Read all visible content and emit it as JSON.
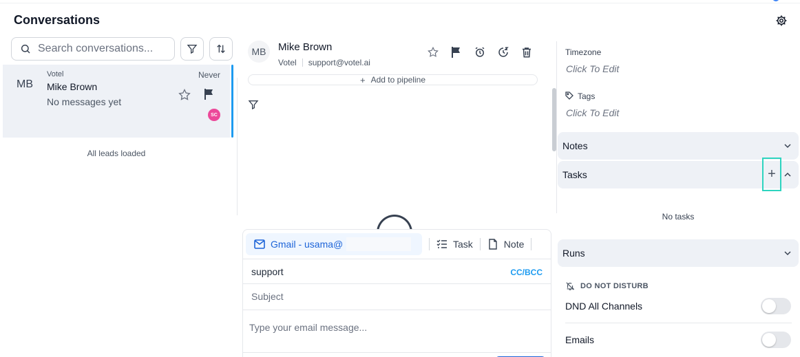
{
  "header": {
    "title": "Conversations"
  },
  "search": {
    "placeholder": "Search conversations..."
  },
  "conversation_list": {
    "items": [
      {
        "avatar": "MB",
        "company": "Votel",
        "name": "Mike Brown",
        "preview": "No messages yet",
        "time": "Never",
        "assignee_badge": "SC"
      }
    ],
    "footer": "All leads loaded"
  },
  "contact": {
    "avatar": "MB",
    "name": "Mike Brown",
    "company": "Votel",
    "email": "support@votel.ai",
    "add_pipeline_label": "Add to pipeline"
  },
  "composer": {
    "tabs": [
      {
        "label": "Gmail - usama@",
        "icon": "mail-icon"
      },
      {
        "label": "Task",
        "icon": "task-list-icon"
      },
      {
        "label": "Note",
        "icon": "note-icon"
      }
    ],
    "to_value": "support",
    "cc_bcc_label": "CC/BCC",
    "subject_placeholder": "Subject",
    "message_placeholder": "Type your email message..."
  },
  "details": {
    "timezone": {
      "label": "Timezone",
      "value": "Click To Edit"
    },
    "tags": {
      "label": "Tags",
      "value": "Click To Edit"
    },
    "sections": {
      "notes": "Notes",
      "tasks": "Tasks",
      "runs": "Runs"
    },
    "add_task_symbol": "+",
    "no_tasks": "No tasks",
    "dnd": {
      "header": "DO NOT DISTURB",
      "rows": [
        {
          "label": "DND All Channels",
          "enabled": false
        },
        {
          "label": "Emails",
          "enabled": false
        }
      ]
    }
  },
  "colors": {
    "accent_blue": "#1d64d8",
    "selection_bar": "#1d9bf0",
    "badge_pink": "#ec4899",
    "highlight_teal": "#2dd4bf",
    "section_bg": "#eef1f6"
  }
}
